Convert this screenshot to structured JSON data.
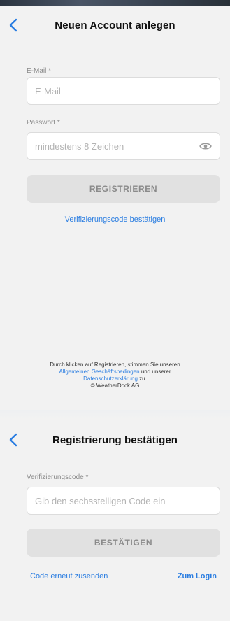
{
  "register": {
    "title": "Neuen Account anlegen",
    "email_label": "E-Mail *",
    "email_placeholder": "E-Mail",
    "password_label": "Passwort *",
    "password_placeholder": "mindestens 8 Zeichen",
    "submit_label": "REGISTRIEREN",
    "verify_link": "Verifizierungscode bestätigen",
    "legal": {
      "text1": "Durch klicken auf Registrieren, stimmen Sie unseren",
      "agb_link": "Allgemeinen Geschäftsbedingen",
      "text2": " und unserer",
      "privacy_link": "Datenschutzerklärung",
      "text3": " zu.",
      "copyright": "© WeatherDock AG"
    }
  },
  "verify": {
    "title": "Registrierung bestätigen",
    "code_label": "Verifizierungscode *",
    "code_placeholder": "Gib den sechsstelligen Code ein",
    "submit_label": "BESTÄTIGEN",
    "resend_link": "Code erneut zusenden",
    "login_link": "Zum Login"
  },
  "colors": {
    "accent": "#2a7de1",
    "background": "#f2f2f2",
    "button_disabled": "#e1e1e1"
  },
  "icons": {
    "back": "chevron-left-icon",
    "password_toggle": "eye-icon"
  }
}
